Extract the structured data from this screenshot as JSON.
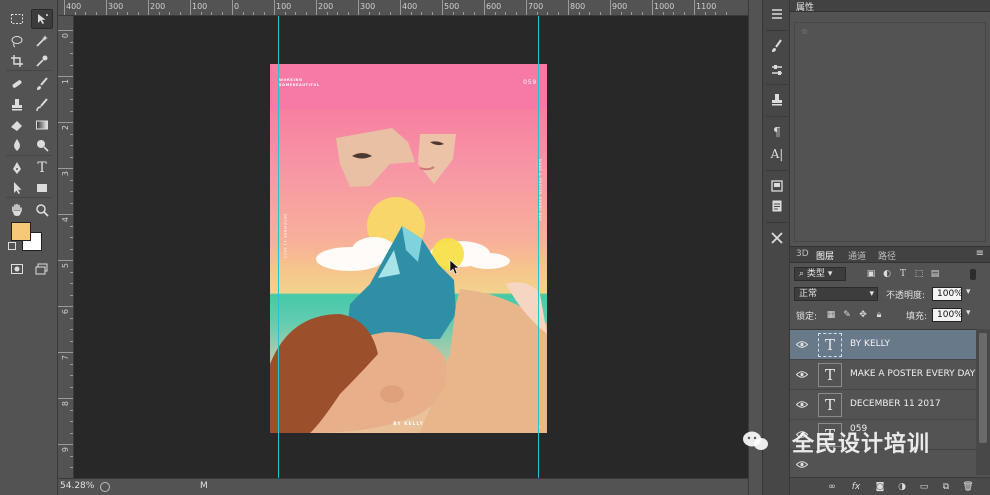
{
  "ruler": {
    "top_labels": [
      "400",
      "300",
      "200",
      "100",
      "0",
      "100",
      "200",
      "300",
      "400",
      "500",
      "600",
      "700",
      "800",
      "900",
      "1000",
      "1100"
    ],
    "left_labels": [
      "0",
      "1",
      "2",
      "3",
      "4",
      "5",
      "6",
      "7",
      "8",
      "9"
    ]
  },
  "toolbar": {
    "tools": [
      {
        "name": "rectangular-marquee-tool",
        "icon": "marquee-icon"
      },
      {
        "name": "move-tool",
        "icon": "move-icon"
      },
      {
        "name": "lasso-tool",
        "icon": "lasso-icon"
      },
      {
        "name": "magic-wand-tool",
        "icon": "wand-icon"
      },
      {
        "name": "crop-tool",
        "icon": "crop-icon"
      },
      {
        "name": "eyedropper-tool",
        "icon": "eyedropper-icon"
      },
      {
        "name": "healing-brush-tool",
        "icon": "bandage-icon"
      },
      {
        "name": "brush-tool",
        "icon": "brush-icon"
      },
      {
        "name": "clone-stamp-tool",
        "icon": "stamp-icon"
      },
      {
        "name": "history-brush-tool",
        "icon": "history-brush-icon"
      },
      {
        "name": "eraser-tool",
        "icon": "eraser-icon"
      },
      {
        "name": "gradient-tool",
        "icon": "gradient-icon"
      },
      {
        "name": "blur-tool",
        "icon": "blur-icon"
      },
      {
        "name": "dodge-tool",
        "icon": "dodge-icon"
      },
      {
        "name": "pen-tool",
        "icon": "pen-icon"
      },
      {
        "name": "type-tool",
        "icon": "type-icon"
      },
      {
        "name": "path-selection-tool",
        "icon": "arrow-icon"
      },
      {
        "name": "shape-tool",
        "icon": "rectangle-icon"
      },
      {
        "name": "hand-tool",
        "icon": "hand-icon"
      },
      {
        "name": "zoom-tool",
        "icon": "magnifier-icon"
      },
      {
        "name": "quick-mask-tool",
        "icon": "mask-icon"
      },
      {
        "name": "screen-mode-tool",
        "icon": "screen-mode-icon"
      }
    ],
    "foreground_color": "#f6c97a",
    "background_color": "#ffffff"
  },
  "poster": {
    "title_lines": [
      "WORKING",
      "SOMEBEAUTIFUL"
    ],
    "number": "059",
    "left_side_text": "DECEMBER 11 2017",
    "right_side_text": "MAKE A POSTER EVERY DAY",
    "footer": "BY KELLY",
    "footer_right": "☆"
  },
  "properties": {
    "tab_label": "属性",
    "hint": "☆"
  },
  "layers_panel": {
    "tabs": [
      "3D",
      "图层",
      "通道",
      "路径"
    ],
    "active_tab": "图层",
    "filter_label": "类型",
    "blend_mode": "正常",
    "opacity_label": "不透明度:",
    "opacity_value": "100%",
    "lock_label": "锁定:",
    "fill_label": "填充:",
    "fill_value": "100%",
    "layers": [
      {
        "name": "BY KELLY",
        "type": "T",
        "selected": true
      },
      {
        "name": "MAKE A POSTER EVERY DAY",
        "type": "T",
        "selected": false
      },
      {
        "name": "DECEMBER 11 2017",
        "type": "T",
        "selected": false
      },
      {
        "name": "059",
        "type": "T",
        "selected": false
      }
    ],
    "footer_icons": [
      "link-icon",
      "fx-icon",
      "mask-icon",
      "adjustment-icon",
      "folder-icon",
      "new-layer-icon",
      "trash-icon"
    ]
  },
  "watermark": {
    "text": "全民设计培训"
  },
  "status": {
    "zoom": "54.28%",
    "info": "M"
  }
}
